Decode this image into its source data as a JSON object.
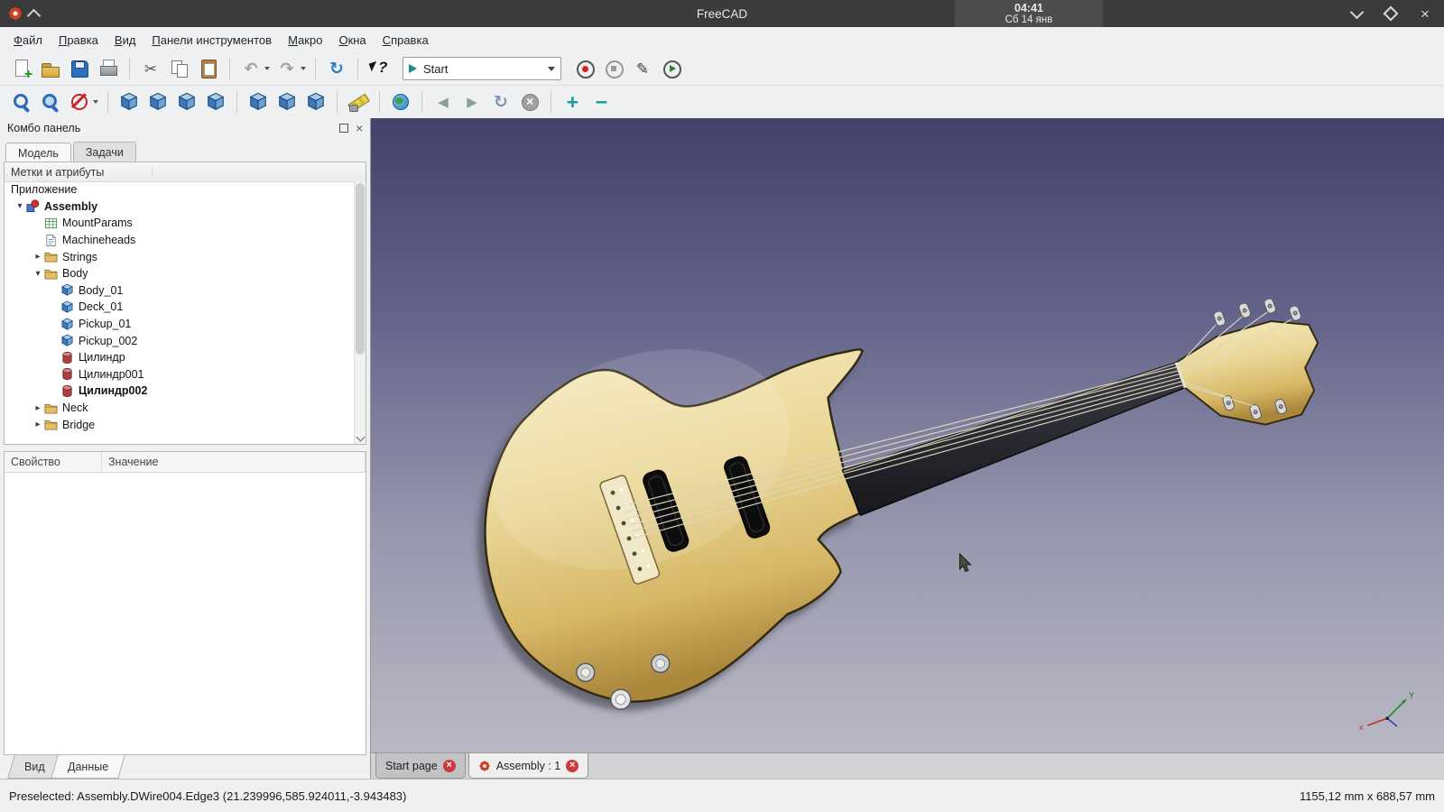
{
  "window": {
    "app_title": "FreeCAD",
    "clock_time": "04:41",
    "clock_date": "Сб 14 янв"
  },
  "menubar": {
    "items": [
      "Файл",
      "Правка",
      "Вид",
      "Панели инструментов",
      "Макро",
      "Окна",
      "Справка"
    ]
  },
  "toolbars": {
    "workbench_selected": "Start",
    "row1_icons": [
      "new-document",
      "open-document",
      "save",
      "print",
      "cut",
      "copy",
      "paste",
      "undo",
      "redo",
      "refresh",
      "whats-this",
      "macro-record",
      "macro-stop",
      "macro-edit",
      "macro-play"
    ],
    "row2_icons": [
      "fit-all",
      "box-zoom",
      "draw-style",
      "axonometric-view",
      "front-view",
      "top-view",
      "right-view",
      "rear-view",
      "bottom-view",
      "left-view",
      "measure",
      "web-globe",
      "nav-back",
      "nav-forward",
      "sync-view",
      "close-view",
      "zoom-in",
      "zoom-out"
    ]
  },
  "combo_panel": {
    "title": "Комбо панель",
    "tabs": [
      {
        "label": "Модель",
        "active": true
      },
      {
        "label": "Задачи",
        "active": false
      }
    ],
    "tree_header": "Метки и атрибуты",
    "tree": [
      {
        "label": "Приложение",
        "level": 0
      },
      {
        "label": "Assembly",
        "level": 1,
        "expanded": true,
        "icon": "assembly",
        "bold": true
      },
      {
        "label": "MountParams",
        "level": 2,
        "icon": "spreadsheet"
      },
      {
        "label": "Machineheads",
        "level": 2,
        "icon": "document"
      },
      {
        "label": "Strings",
        "level": 2,
        "expanded": false,
        "icon": "folder"
      },
      {
        "label": "Body",
        "level": 2,
        "expanded": true,
        "icon": "folder"
      },
      {
        "label": "Body_01",
        "level": 3,
        "icon": "part-cube"
      },
      {
        "label": "Deck_01",
        "level": 3,
        "icon": "part-cube"
      },
      {
        "label": "Pickup_01",
        "level": 3,
        "icon": "part-cube"
      },
      {
        "label": "Pickup_002",
        "level": 3,
        "icon": "part-cube"
      },
      {
        "label": "Цилиндр",
        "level": 3,
        "icon": "part-cylinder"
      },
      {
        "label": "Цилиндр001",
        "level": 3,
        "icon": "part-cylinder"
      },
      {
        "label": "Цилиндр002",
        "level": 3,
        "icon": "part-cylinder",
        "bold": true
      },
      {
        "label": "Neck",
        "level": 2,
        "expanded": false,
        "icon": "folder"
      },
      {
        "label": "Bridge",
        "level": 2,
        "expanded": false,
        "icon": "folder"
      }
    ],
    "property_grid": {
      "columns": [
        "Свойство",
        "Значение"
      ],
      "rows": []
    },
    "bottom_tabs": [
      {
        "label": "Вид",
        "active": false
      },
      {
        "label": "Данные",
        "active": true
      }
    ]
  },
  "viewport": {
    "mdi_tabs": [
      {
        "label": "Start page",
        "active": false
      },
      {
        "label": "Assembly : 1",
        "active": true,
        "icon": "freecad-logo"
      }
    ],
    "background_top": "#41416a",
    "background_bottom": "#b9b9c4",
    "model_body_color": "#e9d494"
  },
  "statusbar": {
    "message": "Preselected: Assembly.DWire004.Edge3 (21.239996,585.924011,-3.943483)",
    "dimensions": "1155,12 mm x 688,57 mm"
  }
}
